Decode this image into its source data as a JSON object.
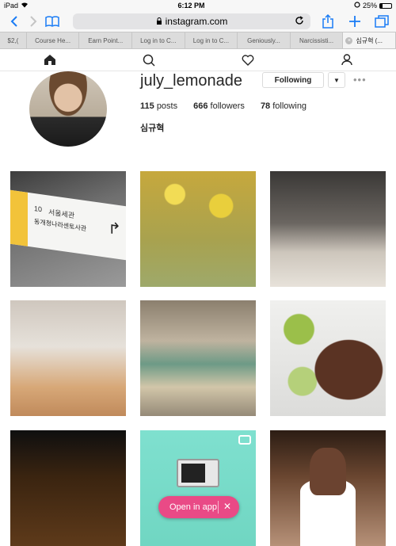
{
  "statusbar": {
    "device": "iPad",
    "time": "6:12 PM",
    "battery": "25%"
  },
  "toolbar": {
    "url": "instagram.com"
  },
  "tabs": [
    "$2,(",
    "Course He...",
    "Earn Point...",
    "Log in to C...",
    "Log in to C...",
    "Geniously...",
    "Narcissisti...",
    "심규혁 (..."
  ],
  "profile": {
    "username": "july_lemonade",
    "follow_label": "Following",
    "posts_count": "115",
    "posts_label": "posts",
    "followers_count": "666",
    "followers_label": "followers",
    "following_count": "78",
    "following_label": "following",
    "fullname": "심규혁"
  },
  "grid_tiles": {
    "subway_sign_line": "10",
    "subway_sign_title": "서울세관",
    "subway_sign_sub": "동개청나라센토사관"
  },
  "open_app": {
    "label": "Open in app",
    "close": "✕"
  },
  "colors": {
    "ios_blue": "#1a7cf5",
    "open_app_pink": "#e94a86"
  }
}
